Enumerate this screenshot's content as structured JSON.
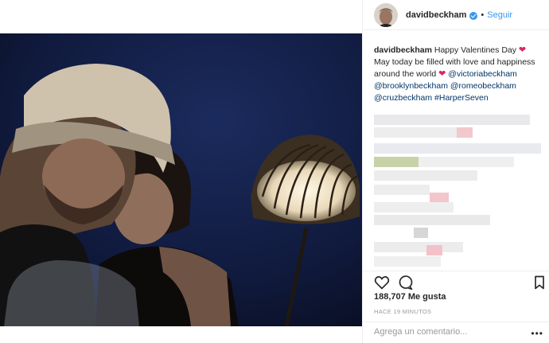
{
  "header": {
    "username": "davidbeckham",
    "separator": "•",
    "follow_label": "Seguir"
  },
  "caption": {
    "username": "davidbeckham",
    "text_1": "Happy Valentines Day",
    "text_2": "May today be filled with love and happiness around the world",
    "mention_1": "@victoriabeckham",
    "mention_2": "@brooklynbeckham",
    "mention_3": "@romeobeckham",
    "mention_4": "@cruzbeckham",
    "hashtag": "#HarperSeven",
    "heart_glyph": "❤"
  },
  "stats": {
    "likes": "188,707 Me gusta",
    "time": "HACE 19 MINUTOS"
  },
  "comment": {
    "placeholder": "Agrega un comentario...",
    "more": "•••"
  },
  "icons": {
    "like": "heart-outline-icon",
    "comment": "speech-bubble-icon",
    "save": "bookmark-icon",
    "verified": "verified-badge-icon"
  },
  "colors": {
    "accent": "#3897f0",
    "heart": "#e0245e",
    "mention": "#003569",
    "muted": "#999999"
  }
}
